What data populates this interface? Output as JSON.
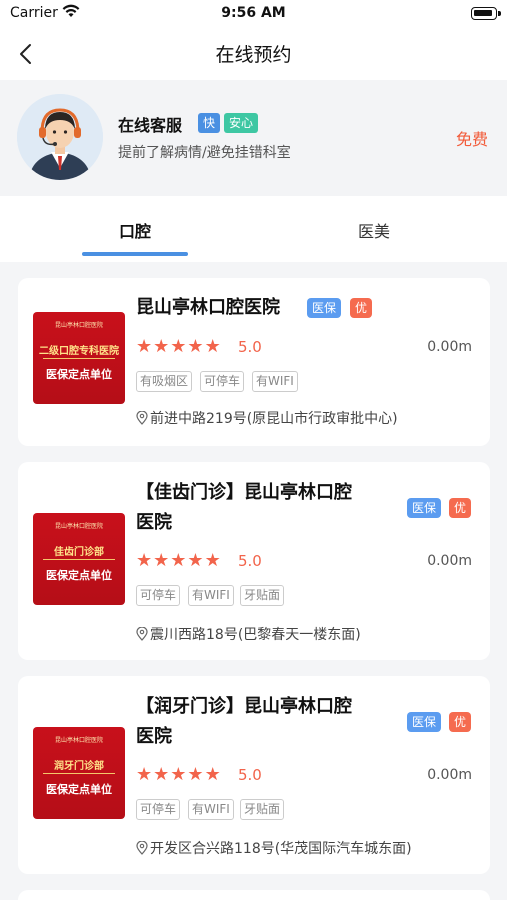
{
  "status_bar": {
    "carrier": "Carrier",
    "time": "9:56 AM"
  },
  "nav": {
    "title": "在线预约",
    "back_icon": "chevron-left-icon"
  },
  "service": {
    "name": "在线客服",
    "tag_fast": "快",
    "tag_safe": "安心",
    "subtitle": "提前了解病情/避免挂错科室",
    "free_label": "免费"
  },
  "tabs": [
    {
      "label": "口腔",
      "active": true
    },
    {
      "label": "医美",
      "active": false
    }
  ],
  "colors": {
    "accent": "#4a90e2",
    "price_red": "#f25b3a",
    "badge_blue": "#5b9cf0",
    "badge_red": "#f56b4f",
    "star": "#f2644b"
  },
  "clinics": [
    {
      "name": "昆山亭林口腔医院",
      "badge_1": "医保",
      "badge_2": "优",
      "stars": 5,
      "rating": "5.0",
      "distance": "0.00m",
      "features": [
        "有吸烟区",
        "可停车",
        "有WIFI"
      ],
      "address": "前进中路219号(原昆山市行政审批中心)",
      "thumb": {
        "logo": "昆山亭林口腔医院",
        "line1": "二级口腔专科医院",
        "line2": "医保定点单位"
      }
    },
    {
      "name_line1": "【佳齿门诊】昆山亭林口腔",
      "name_line2": "医院",
      "badge_1": "医保",
      "badge_2": "优",
      "stars": 5,
      "rating": "5.0",
      "distance": "0.00m",
      "features": [
        "可停车",
        "有WIFI",
        "牙贴面"
      ],
      "address": "震川西路18号(巴黎春天一楼东面)",
      "thumb": {
        "logo": "昆山亭林口腔医院",
        "line1": "佳齿门诊部",
        "line2": "医保定点单位"
      }
    },
    {
      "name_line1": "【润牙门诊】昆山亭林口腔",
      "name_line2": "医院",
      "badge_1": "医保",
      "badge_2": "优",
      "stars": 5,
      "rating": "5.0",
      "distance": "0.00m",
      "features": [
        "可停车",
        "有WIFI",
        "牙贴面"
      ],
      "address": "开发区合兴路118号(华茂国际汽车城东面)",
      "thumb": {
        "logo": "昆山亭林口腔医院",
        "line1": "润牙门诊部",
        "line2": "医保定点单位"
      }
    }
  ]
}
